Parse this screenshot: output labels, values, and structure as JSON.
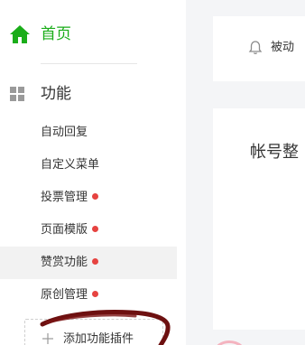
{
  "sidebar": {
    "home": {
      "label": "首页",
      "icon": "home-icon"
    },
    "section": {
      "label": "功能",
      "icon": "grid-icon"
    },
    "items": [
      {
        "label": "自动回复",
        "badge": false,
        "active": false
      },
      {
        "label": "自定义菜单",
        "badge": false,
        "active": false
      },
      {
        "label": "投票管理",
        "badge": true,
        "active": false
      },
      {
        "label": "页面模版",
        "badge": true,
        "active": false
      },
      {
        "label": "赞赏功能",
        "badge": true,
        "active": true
      },
      {
        "label": "原创管理",
        "badge": true,
        "active": false
      }
    ],
    "add_plugin": {
      "label": "添加功能插件",
      "icon": "plus-icon"
    }
  },
  "notice": {
    "icon": "bell-icon",
    "text": "被动"
  },
  "main": {
    "title": "帐号整"
  },
  "colors": {
    "accent_green": "#1aad19",
    "badge_red": "#e64340",
    "annotation_red": "#6d1010",
    "background": "#f4f5f7"
  }
}
